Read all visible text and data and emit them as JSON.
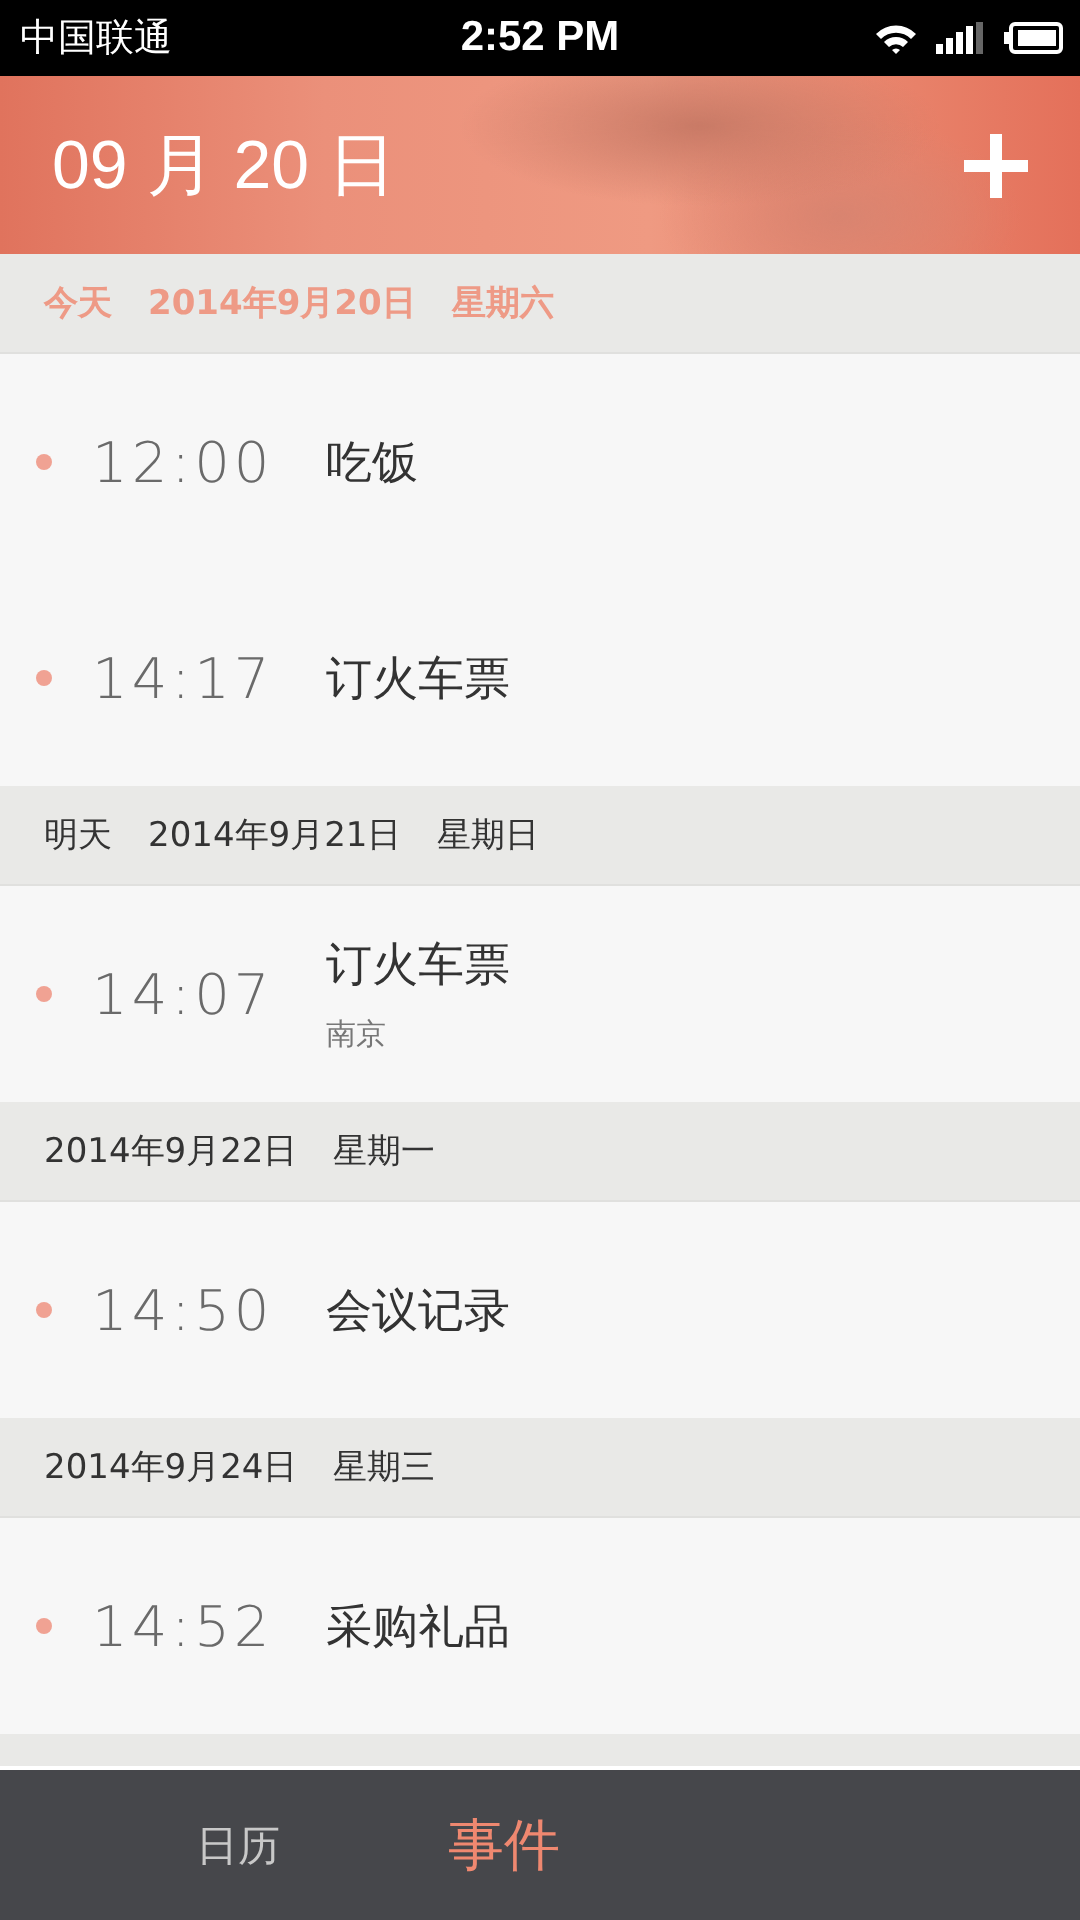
{
  "status_bar": {
    "carrier": "中国联通",
    "time": "2:52 PM"
  },
  "header": {
    "title": "09 月 20 日"
  },
  "sections": [
    {
      "highlighted": true,
      "labels": [
        "今天",
        "2014年9月20日",
        "星期六"
      ],
      "events": [
        {
          "time": "12:00",
          "title": "吃饭"
        },
        {
          "time": "14:17",
          "title": "订火车票"
        }
      ]
    },
    {
      "highlighted": false,
      "labels": [
        "明天",
        "2014年9月21日",
        "星期日"
      ],
      "events": [
        {
          "time": "14:07",
          "title": "订火车票",
          "location": "南京"
        }
      ]
    },
    {
      "highlighted": false,
      "labels": [
        "2014年9月22日",
        "星期一"
      ],
      "events": [
        {
          "time": "14:50",
          "title": "会议记录"
        }
      ]
    },
    {
      "highlighted": false,
      "labels": [
        "2014年9月24日",
        "星期三"
      ],
      "events": [
        {
          "time": "14:52",
          "title": "采购礼品"
        }
      ]
    }
  ],
  "tabs": [
    {
      "label": "日历",
      "selected": false
    },
    {
      "label": "事件",
      "selected": true
    }
  ]
}
